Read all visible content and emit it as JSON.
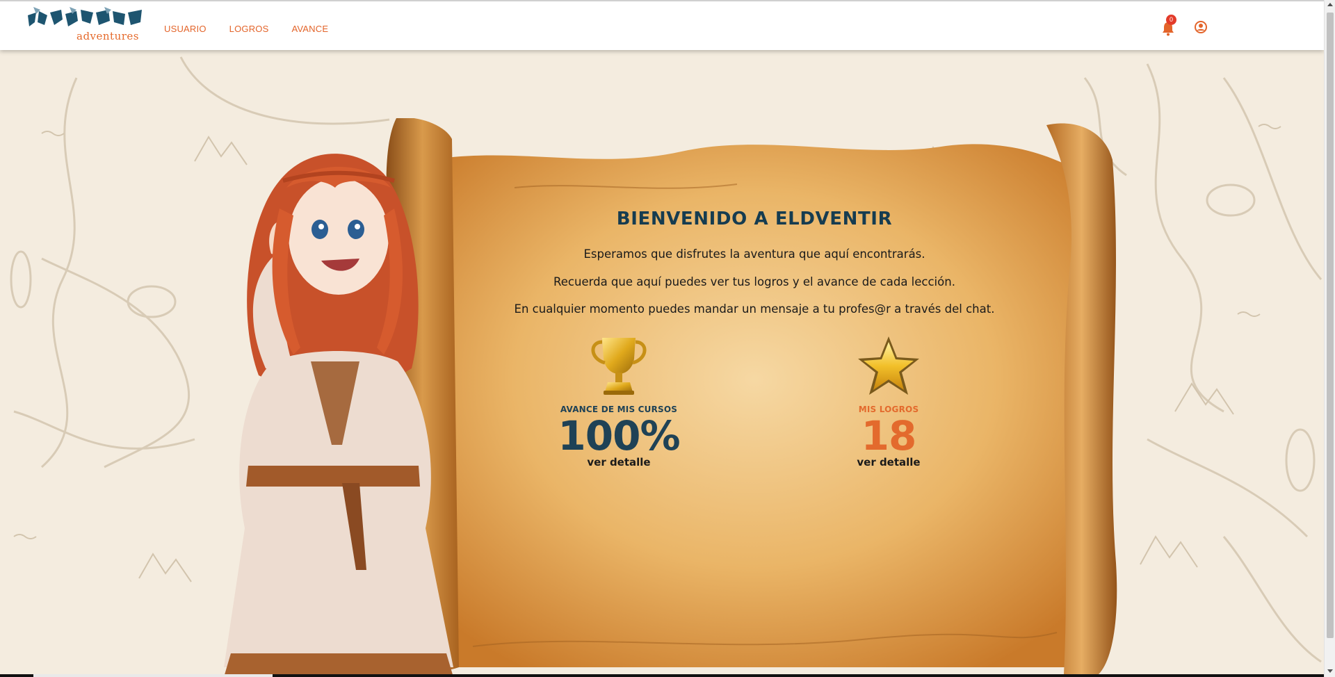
{
  "header": {
    "logo_text": "adventures",
    "nav": [
      "USUARIO",
      "LOGROS",
      "AVANCE"
    ],
    "notification_count": "0"
  },
  "welcome": {
    "title": "BIENVENIDO A ELDVENTIR",
    "line1": "Esperamos que disfrutes la aventura que aquí encontrarás.",
    "line2": "Recuerda que aquí puedes ver tus logros y el avance de cada lección.",
    "line3": "En cualquier momento puedes mandar un mensaje a tu profes@r a través del chat."
  },
  "stats": {
    "progress": {
      "label": "AVANCE DE MIS CURSOS",
      "value": "100%",
      "link": "ver detalle",
      "icon": "trophy-icon"
    },
    "achievements": {
      "label": "MIS LOGROS",
      "value": "18",
      "link": "ver detalle",
      "icon": "star-icon"
    }
  },
  "colors": {
    "accent": "#e36a2d",
    "navy": "#1f4256",
    "parchment": "#e9b15f"
  }
}
